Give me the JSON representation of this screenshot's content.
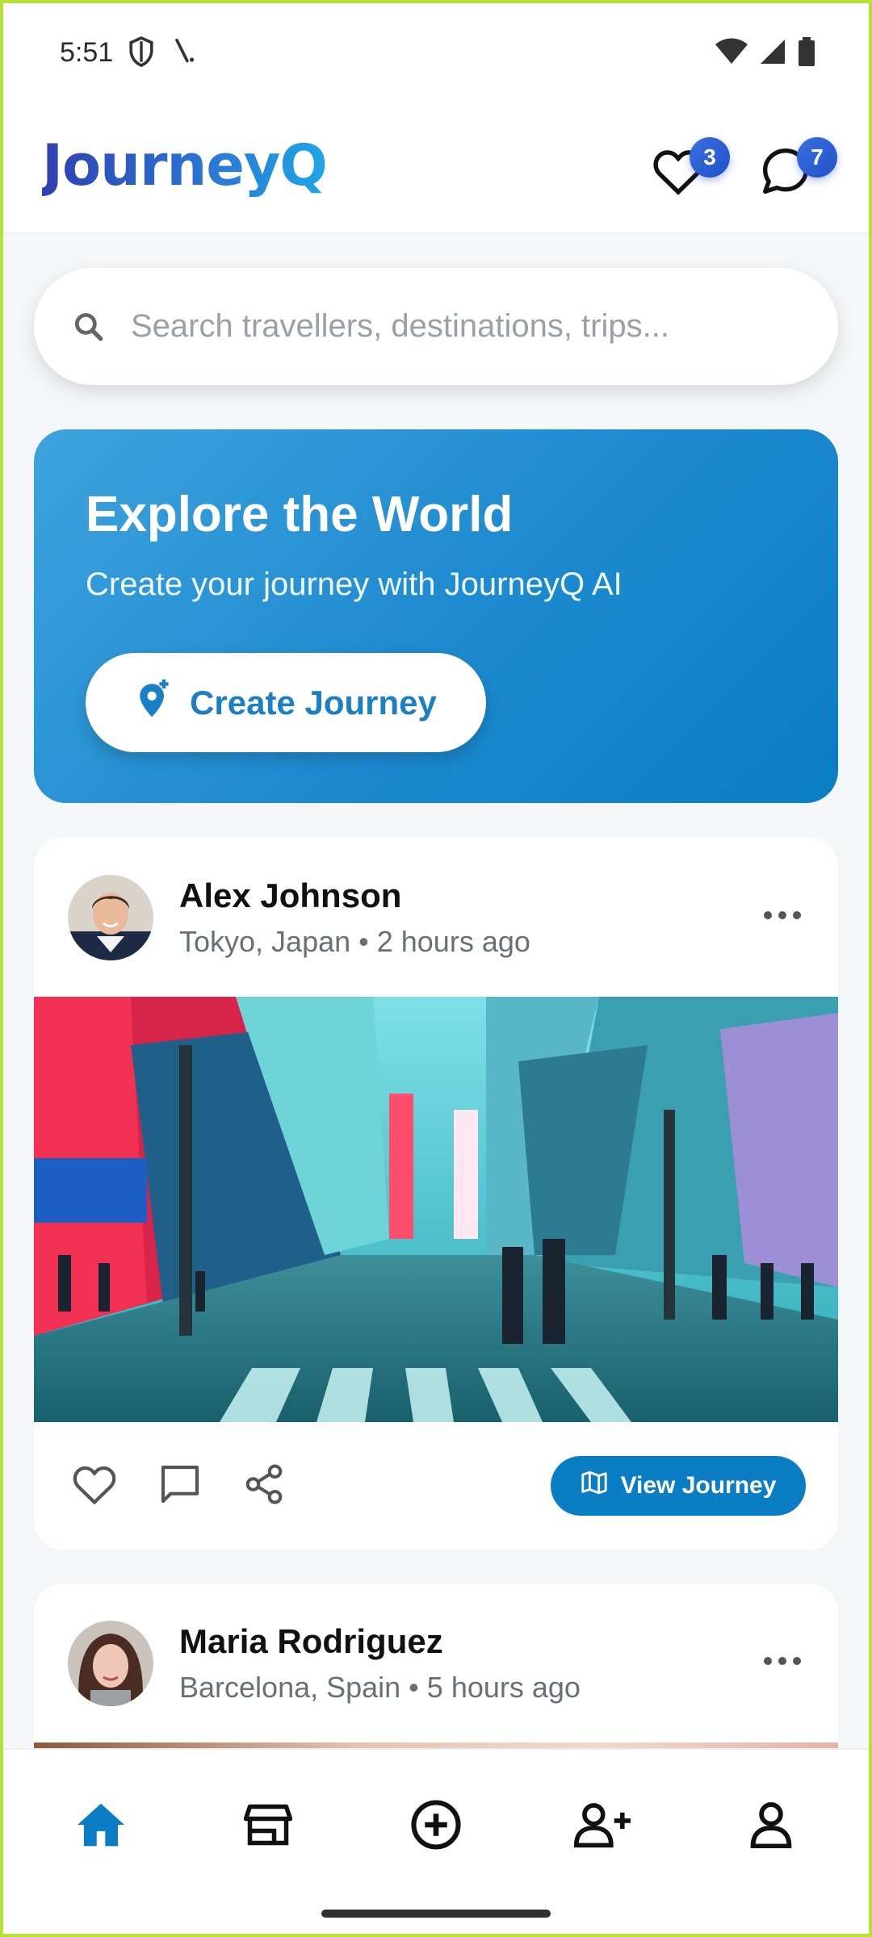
{
  "status_bar": {
    "time": "5:51"
  },
  "header": {
    "logo": "JourneyQ",
    "favorites_count": "3",
    "messages_count": "7"
  },
  "search": {
    "placeholder": "Search travellers, destinations, trips..."
  },
  "hero": {
    "title": "Explore the World",
    "subtitle": "Create your journey with JourneyQ AI",
    "button_label": "Create Journey"
  },
  "posts": [
    {
      "user": "Alex Johnson",
      "location": "Tokyo, Japan",
      "time": "2 hours ago",
      "meta": "Tokyo, Japan • 2 hours ago",
      "image_icon": "city-street-photo",
      "view_label": "View Journey"
    },
    {
      "user": "Maria Rodriguez",
      "location": "Barcelona, Spain",
      "time": "5 hours ago",
      "meta": "Barcelona, Spain • 5 hours ago"
    }
  ],
  "bottom_nav": {
    "items": [
      {
        "name": "home",
        "icon": "home-icon",
        "active": true
      },
      {
        "name": "store",
        "icon": "store-icon",
        "active": false
      },
      {
        "name": "create",
        "icon": "add-circle-icon",
        "active": false
      },
      {
        "name": "add-friend",
        "icon": "person-add-icon",
        "active": false
      },
      {
        "name": "profile",
        "icon": "person-icon",
        "active": false
      }
    ]
  },
  "colors": {
    "accent": "#0b7dc4",
    "badge": "#2f5fd6",
    "hero_start": "#3da3dc",
    "hero_end": "#0b7dc4"
  }
}
